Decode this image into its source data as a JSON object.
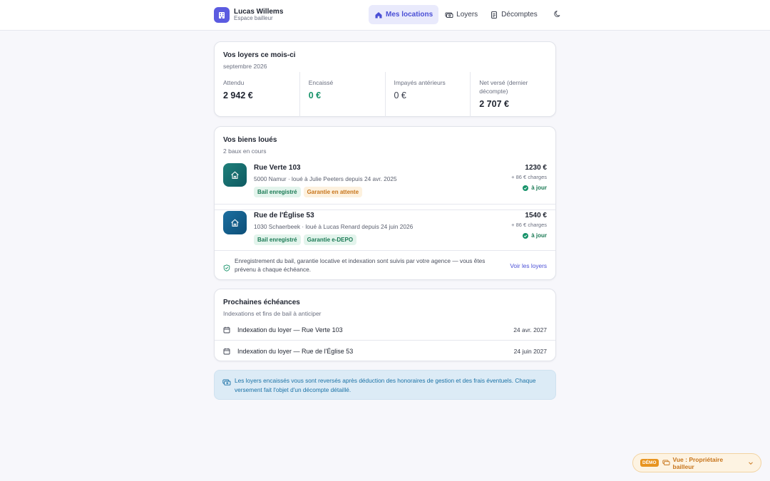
{
  "header": {
    "user_name": "Lucas Willems",
    "user_role": "Espace bailleur",
    "nav": [
      {
        "label": "Mes locations",
        "icon": "home-icon",
        "active": true
      },
      {
        "label": "Loyers",
        "icon": "money-icon",
        "active": false
      },
      {
        "label": "Décomptes",
        "icon": "document-icon",
        "active": false
      }
    ],
    "theme_icon": "moon-icon"
  },
  "summary": {
    "title": "Vos loyers ce mois-ci",
    "period": "septembre 2026",
    "stats": [
      {
        "label": "Attendu",
        "value": "2 942 €"
      },
      {
        "label": "Encaissé",
        "value": "0 €"
      },
      {
        "label": "Impayés antérieurs",
        "value": "0 €"
      },
      {
        "label": "Net versé (dernier décompte)",
        "value": "2 707 €"
      }
    ]
  },
  "properties": {
    "title": "Vos biens loués",
    "count": "2 baux en cours",
    "items": [
      {
        "name": "Rue Verte 103",
        "description": "5000 Namur · loué à Julie Peeters depuis 24 avr. 2025",
        "tags": [
          "Bail enregistré",
          "Garantie en attente"
        ],
        "rent": "1230 €",
        "charges": "+ 86 € charges",
        "status": "à jour"
      },
      {
        "name": "Rue de l'Église 53",
        "description": "1030 Schaerbeek · loué à Lucas Renard depuis 24 juin 2026",
        "tags": [
          "Bail enregistré",
          "Garantie e-DEPO"
        ],
        "rent": "1540 €",
        "charges": "+ 86 € charges",
        "status": "à jour"
      }
    ],
    "note": "Enregistrement du bail, garantie locative et indexation sont suivis par votre agence — vous êtes prévenu à chaque échéance.",
    "note_link": "Voir les loyers"
  },
  "deadlines": {
    "title": "Prochaines échéances",
    "subtitle": "Indexations et fins de bail à anticiper",
    "items": [
      {
        "label": "Indexation du loyer — Rue Verte 103",
        "date": "24 avr. 2027"
      },
      {
        "label": "Indexation du loyer — Rue de l'Église 53",
        "date": "24 juin 2027"
      }
    ]
  },
  "banner": {
    "text": "Les loyers encaissés vous sont reversés après déduction des honoraires de gestion et des frais éventuels. Chaque versement fait l'objet d'un décompte détaillé."
  },
  "demo": {
    "badge": "DÉMO",
    "label": "Vue : Propriétaire bailleur"
  },
  "colors": {
    "accent": "#4a4fd6",
    "success": "#17936a",
    "warning": "#c7741a",
    "info": "#1b72a6"
  }
}
